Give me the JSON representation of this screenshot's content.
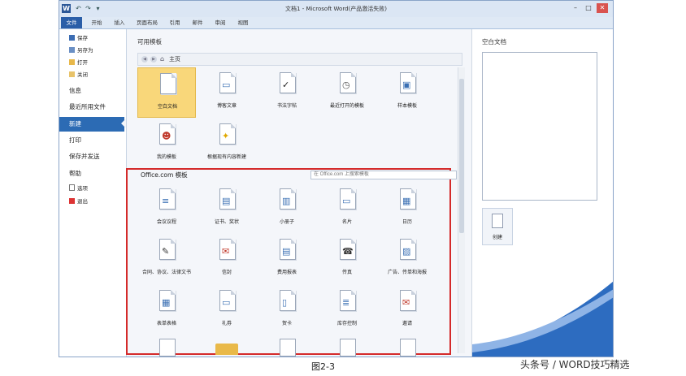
{
  "window": {
    "title": "文档1 - Microsoft Word(产品激活失败)",
    "controls": [
      "–",
      "□",
      "✕"
    ]
  },
  "quick_access": [
    "W",
    "↶",
    "↷",
    "▾"
  ],
  "tabs": [
    "文件",
    "开始",
    "插入",
    "页面布局",
    "引用",
    "邮件",
    "审阅",
    "视图"
  ],
  "nav": {
    "save": "保存",
    "save_as": "另存为",
    "open": "打开",
    "close": "关闭",
    "info": "信息",
    "recent": "最近所用文件",
    "new": "新建",
    "print": "打印",
    "save_send": "保存并发送",
    "help": "帮助",
    "options": "选项",
    "exit": "退出"
  },
  "available": {
    "label": "可用模板",
    "breadcrumb": "主页",
    "templates": [
      "空白文档",
      "博客文章",
      "书法字帖",
      "最近打开的模板",
      "样本模板",
      "我的模板",
      "根据现有内容新建"
    ]
  },
  "office": {
    "title": "Office.com 模板",
    "search_placeholder": "在 Office.com 上搜索模板",
    "templates": [
      "会议议程",
      "证书、奖状",
      "小册子",
      "名片",
      "日历",
      "合同、协议、法律文书",
      "信封",
      "费用报表",
      "传真",
      "广告、传单和海报",
      "表单表格",
      "礼券",
      "贺卡",
      "库存控制",
      "邀请"
    ]
  },
  "pane": {
    "title": "空白文档",
    "create": "创建"
  },
  "caption": "图2-3",
  "watermark": "头条号 / WORD技巧精选"
}
